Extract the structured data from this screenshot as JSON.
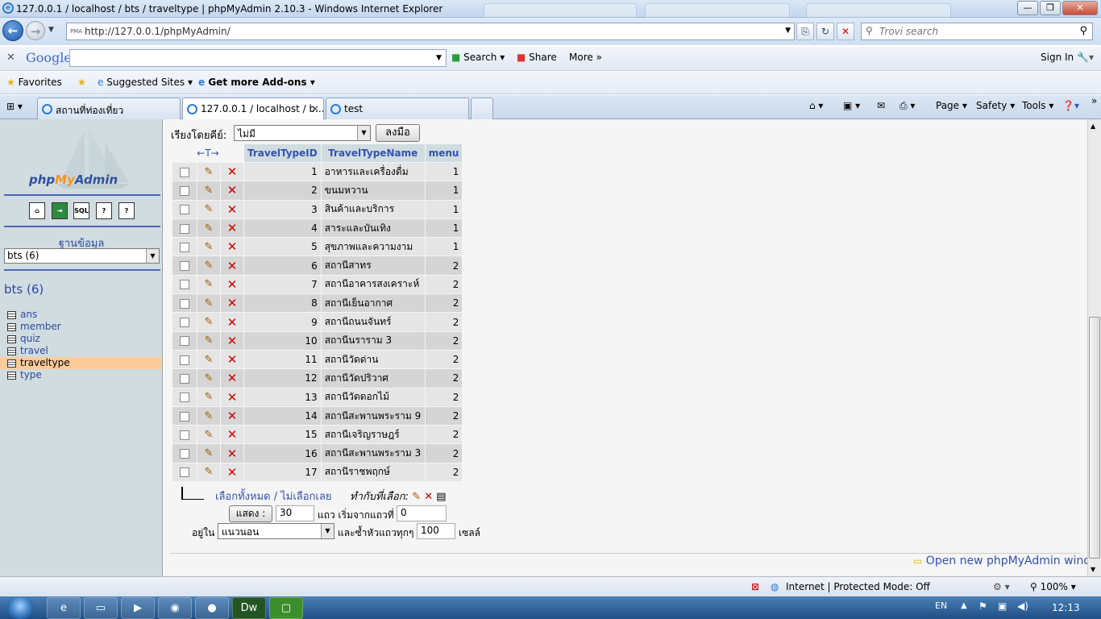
{
  "window": {
    "title": "127.0.0.1 / localhost / bts / traveltype | phpMyAdmin 2.10.3 - Windows Internet Explorer",
    "url": "http://127.0.0.1/phpMyAdmin/",
    "search_placeholder": "Trovi search"
  },
  "google_bar": {
    "logo": "Google",
    "search_label": "Search",
    "share_label": "Share",
    "more_label": "More »",
    "signin_label": "Sign In"
  },
  "favorites_bar": {
    "favorites_label": "Favorites",
    "suggested_label": "Suggested Sites",
    "addons_label": "Get more Add-ons"
  },
  "tabs": [
    {
      "label": "สถานที่ท่องเที่ยว"
    },
    {
      "label": "127.0.0.1 / localhost / b..."
    },
    {
      "label": "test"
    }
  ],
  "command_bar": {
    "page": "Page",
    "safety": "Safety",
    "tools": "Tools"
  },
  "sidebar": {
    "logo_text_a": "php",
    "logo_text_b": "My",
    "logo_text_c": "Admin",
    "icons": [
      "home-icon",
      "sql-icon",
      "query-icon",
      "docs-icon",
      "docs2-icon"
    ],
    "icon_text": [
      "",
      "",
      "SQL",
      "",
      ""
    ],
    "database_label": "ฐานข้อมูล",
    "database_selected": "bts (6)",
    "db_heading": "bts (6)",
    "tables": [
      "ans",
      "member",
      "quiz",
      "travel",
      "traveltype",
      "type"
    ],
    "selected_table": "traveltype"
  },
  "main": {
    "sort_label": "เรียงโดยคีย์:",
    "sort_selected": "ไม่มี",
    "go_button": "ลงมือ",
    "arrows_header": "←T→",
    "columns": [
      "TravelTypeID",
      "TravelTypeName",
      "menu"
    ],
    "rows": [
      {
        "id": "1",
        "name": "อาหารและเครื่องดื่ม",
        "menu": "1"
      },
      {
        "id": "2",
        "name": "ขนมหวาน",
        "menu": "1"
      },
      {
        "id": "3",
        "name": "สินค้าและบริการ",
        "menu": "1"
      },
      {
        "id": "4",
        "name": "สาระและบันเทิง",
        "menu": "1"
      },
      {
        "id": "5",
        "name": "สุขภาพและความงาม",
        "menu": "1"
      },
      {
        "id": "6",
        "name": "สถานีสาทร",
        "menu": "2"
      },
      {
        "id": "7",
        "name": "สถานีอาคารสงเคราะห์",
        "menu": "2"
      },
      {
        "id": "8",
        "name": "สถานีเย็นอากาศ",
        "menu": "2"
      },
      {
        "id": "9",
        "name": "สถานีถนนจันทร์",
        "menu": "2"
      },
      {
        "id": "10",
        "name": "สถานีนราราม 3",
        "menu": "2"
      },
      {
        "id": "11",
        "name": "สถานีวัดด่าน",
        "menu": "2"
      },
      {
        "id": "12",
        "name": "สถานีวัดปริวาศ",
        "menu": "2"
      },
      {
        "id": "13",
        "name": "สถานีวัดดอกไม้",
        "menu": "2"
      },
      {
        "id": "14",
        "name": "สถานีสะพานพระราม 9",
        "menu": "2"
      },
      {
        "id": "15",
        "name": "สถานีเจริญราษฎร์",
        "menu": "2"
      },
      {
        "id": "16",
        "name": "สถานีสะพานพระราม 3",
        "menu": "2"
      },
      {
        "id": "17",
        "name": "สถานีราชพฤกษ์",
        "menu": "2"
      }
    ],
    "check_all": "เลือกทั้งหมด / ไม่เลือกเลย",
    "with_selected": "ทำกับที่เลือก:",
    "show_button": "แสดง :",
    "rows_value": "30",
    "start_label": "แถว เริ่มจากแถวที่",
    "start_value": "0",
    "mode_label": "อยู่ใน",
    "mode_selected": "แนวนอน",
    "repeat_label": "และซ้ำหัวแถวทุกๆ",
    "repeat_value": "100",
    "cells_label": "เซลล์",
    "open_new_window": "Open new phpMyAdmin window"
  },
  "status_bar": {
    "zone": "Internet | Protected Mode: Off",
    "zoom": "100%"
  },
  "taskbar": {
    "lang": "EN",
    "time": "12:13"
  }
}
